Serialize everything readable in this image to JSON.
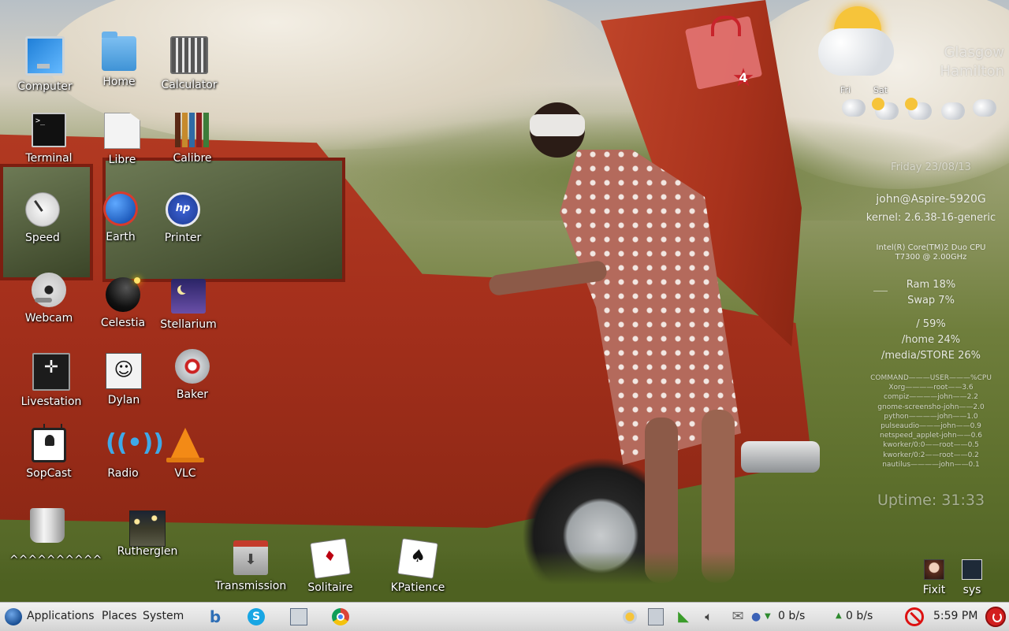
{
  "desktop": {
    "icons_row1": [
      {
        "label": "Computer",
        "icon": "computer-icon"
      },
      {
        "label": "Home",
        "icon": "home-folder-icon"
      },
      {
        "label": "Calculator",
        "icon": "calculator-icon"
      }
    ],
    "icons_row2": [
      {
        "label": "Terminal",
        "icon": "terminal-icon"
      },
      {
        "label": "Libre",
        "icon": "document-icon"
      },
      {
        "label": "Calibre",
        "icon": "books-icon"
      }
    ],
    "icons_row3": [
      {
        "label": "Speed",
        "icon": "gauge-icon"
      },
      {
        "label": "Earth",
        "icon": "globe-icon"
      },
      {
        "label": "Printer",
        "icon": "printer-hp-icon"
      }
    ],
    "icons_row4": [
      {
        "label": "Webcam",
        "icon": "webcam-icon"
      },
      {
        "label": "Celestia",
        "icon": "planet-icon"
      },
      {
        "label": "Stellarium",
        "icon": "night-sky-icon"
      }
    ],
    "icons_row5": [
      {
        "label": "Livestation",
        "icon": "livestation-icon"
      },
      {
        "label": "Dylan",
        "icon": "portrait-icon"
      },
      {
        "label": "Baker",
        "icon": "disc-burner-icon"
      }
    ],
    "icons_row6": [
      {
        "label": "SopCast",
        "icon": "tv-icon"
      },
      {
        "label": "Radio",
        "icon": "radio-signal-icon"
      },
      {
        "label": "VLC",
        "icon": "vlc-cone-icon"
      }
    ],
    "icons_row7": [
      {
        "label": "^^^^^^^^^^",
        "icon": "trash-icon"
      },
      {
        "label": "Rutherglen",
        "icon": "photo-thumbnail-icon"
      },
      {
        "label": "Transmission",
        "icon": "transmission-icon"
      },
      {
        "label": "Solitaire",
        "icon": "cards-icon"
      },
      {
        "label": "KPatience",
        "icon": "cards-spade-icon"
      }
    ],
    "corner_icons": [
      {
        "label": "Fixit",
        "icon": "avatar-icon"
      },
      {
        "label": "sys",
        "icon": "sys-icon"
      }
    ],
    "terminal_prompt": ">_"
  },
  "calendar_widget": {
    "badge": "4",
    "icon": "calendar-icon",
    "accent": "#c8232b"
  },
  "conky": {
    "location_line1": "Glasgow",
    "location_line2": "Hamilton",
    "forecast": [
      {
        "day": "Fri",
        "icon": "rain-cloud-icon",
        "temp": ""
      },
      {
        "day": "Sat",
        "icon": "partly-sunny-icon",
        "temp": ""
      },
      {
        "day": "",
        "icon": "partly-sunny-icon",
        "temp": ""
      },
      {
        "day": "",
        "icon": "cloud-icon",
        "temp": ""
      },
      {
        "day": "",
        "icon": "rain-cloud-icon",
        "temp": ""
      }
    ],
    "date": "Friday 23/08/13",
    "user_host": "john@Aspire-5920G",
    "kernel": "kernel: 2.6.38-16-generic",
    "cpu_line1": "Intel(R) Core(TM)2 Duo CPU",
    "cpu_line2": "T7300  @ 2.00GHz",
    "ram": "Ram 18%",
    "swap": "Swap 7%",
    "fs_root": "/ 59%",
    "fs_home": "/home 24%",
    "fs_store": "/media/STORE 26%",
    "proc_header": "COMMAND———USER———%CPU",
    "processes": [
      "Xorg————root——3.6",
      "compiz————john——2.2",
      "gnome-screensho-john——2.0",
      "python————john——1.0",
      "pulseaudio———john——0.9",
      "netspeed_applet-john——0.6",
      "kworker/0:0——root——0.5",
      "kworker/0:2——root——0.2",
      "nautilus————john——0.1"
    ],
    "uptime": "Uptime: 31:33"
  },
  "panel": {
    "menus": [
      "Applications",
      "Places",
      "System"
    ],
    "launchers": [
      {
        "name": "bluefish",
        "icon": "b-editor-icon",
        "glyph": "b"
      },
      {
        "name": "skype",
        "icon": "skype-icon",
        "glyph": "S"
      },
      {
        "name": "screenshot",
        "icon": "screenshot-icon"
      },
      {
        "name": "chrome",
        "icon": "chrome-icon"
      }
    ],
    "net_down": "0 b/s",
    "net_up": "0 b/s",
    "clock": "5:59 PM",
    "tray_icons": [
      "weather-icon",
      "clipboard-icon",
      "wifi-icon",
      "volume-icon",
      "mail-icon",
      "network-icon",
      "no-entry-icon",
      "power-icon"
    ]
  }
}
